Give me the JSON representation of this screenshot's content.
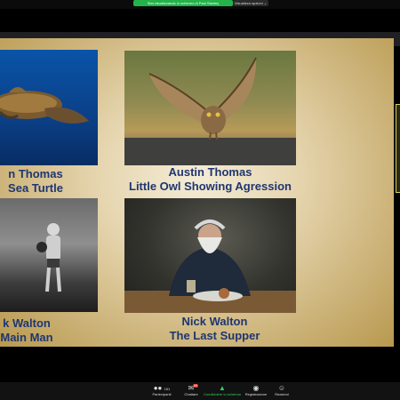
{
  "topbar": {
    "share_label": "Stai visualizzando lo schermo di Paul Stanley",
    "view_options": "Visualizza opzioni ⌄"
  },
  "slide": {
    "entries": [
      {
        "name": "n Thomas",
        "title": "Sea Turtle"
      },
      {
        "name": "Austin Thomas",
        "title": "Little Owl Showing Agression"
      },
      {
        "name": "k Walton",
        "title": "Main Man"
      },
      {
        "name": "Nick Walton",
        "title": "The Last Supper"
      }
    ]
  },
  "toolbar": {
    "participants_label": "Partecipanti",
    "participants_count": "161",
    "chat_label": "Chattare",
    "chat_badge": "99",
    "share_label": "Condividere lo schermo",
    "record_label": "Registrazione",
    "reactions_label": "Reazioni"
  },
  "icons": {
    "participants": "people-icon",
    "chat": "chat-icon",
    "share": "share-screen-icon",
    "record": "record-icon",
    "reactions": "reactions-icon"
  },
  "colors": {
    "share_green": "#23b34a",
    "caption_blue": "#1e3670",
    "badge_red": "#e5322e",
    "slide_gold": "#cdb47b"
  }
}
